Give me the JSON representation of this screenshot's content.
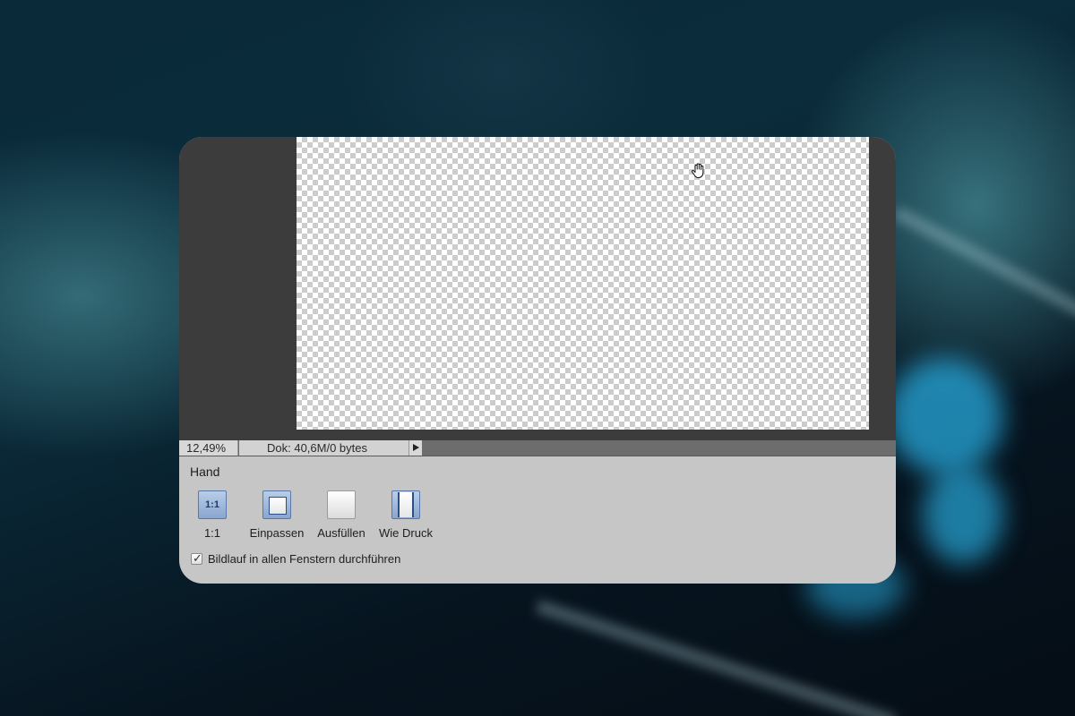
{
  "status_bar": {
    "zoom": "12,49%",
    "doc_info": "Dok: 40,6M/0 bytes"
  },
  "tool_options": {
    "title": "Hand",
    "buttons": [
      {
        "icon_text": "1:1",
        "label": "1:1",
        "selected": true
      },
      {
        "label": "Einpassen",
        "selected": true
      },
      {
        "label": "Ausfüllen",
        "selected": false
      },
      {
        "label": "Wie Druck",
        "selected": true
      }
    ],
    "scroll_all": {
      "label": "Bildlauf in allen Fenstern durchführen",
      "checked": true,
      "mark": "✓"
    }
  },
  "colors": {
    "canvas_bg": "#3c3c3c",
    "panel_bg": "#c6c6c6",
    "accent_blue": "#8aa6cf"
  }
}
